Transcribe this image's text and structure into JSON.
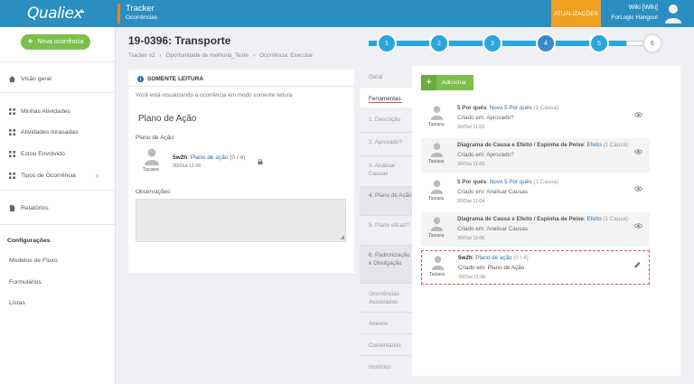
{
  "header": {
    "logo": "Qualiex",
    "module_title": "Tracker",
    "module_subtitle": "Ocorrências",
    "updates_label": "ATUALIZAÇÕES",
    "user_name": "Wiki [Wiki]",
    "user_org": "ForLogic Hangout",
    "accent_color": "#2a8fc0"
  },
  "sidebar": {
    "new_button": "Nova ocorrência",
    "items": [
      {
        "label": "Visão geral",
        "icon": "home-icon"
      },
      {
        "label": "Minhas Atividades",
        "icon": "grid-icon"
      },
      {
        "label": "Atividades Atrasadas",
        "icon": "grid-icon"
      },
      {
        "label": "Estou Envolvido",
        "icon": "grid-icon"
      },
      {
        "label": "Tipos de Ocorrência",
        "icon": "grid-icon"
      },
      {
        "label": "Relatórios",
        "icon": "document-icon"
      }
    ],
    "config_heading": "Configurações",
    "config_items": [
      "Modelos de Fluxo",
      "Formulários",
      "Listas"
    ]
  },
  "page": {
    "title": "19-0396: Transporte",
    "breadcrumb": [
      "Tracker v2",
      "›",
      "Oportunidade de melhoria_Teste",
      "›",
      "Ocorrência: Executar"
    ]
  },
  "steps": {
    "labels": [
      "1",
      "2",
      "3",
      "4",
      "5",
      "6"
    ],
    "current": 4
  },
  "readonly": {
    "heading": "SOMENTE LEITURA",
    "text": "Você está visualizando a ocorrência em modo somente leitura"
  },
  "plan": {
    "title": "Plano de Ação",
    "label": "Plano de Ação:",
    "user": "Taciara",
    "tool_name": "5w2h",
    "link": "Plano de ação",
    "count": "(0 / 4)",
    "date": "30/Out 11:06",
    "obs_label": "Observações:"
  },
  "tabs": {
    "items": [
      "Geral",
      "Ferramentas",
      "1. Descrição",
      "2. Aprovado?",
      "3. Analisar Causas",
      "4. Plano de Ação",
      "5. Plano eficaz?",
      "6. Padronização e Divulgação",
      "Ocorrências Associadas",
      "Anexos",
      "Comentários",
      "Histórico"
    ]
  },
  "tools": {
    "add_button": "Adicionar",
    "items": [
      {
        "user": "Taciara",
        "name": "5 Por quês",
        "link": "Novo 5 Por quês",
        "count": "(1 Causa)",
        "created": "Criado em: Aprovado?",
        "date": "30/Out 11:03",
        "action": "eye-icon"
      },
      {
        "user": "Taciara",
        "name": "Diagrama de Causa e Efeito / Espinha de Peixe",
        "link": "Efeito",
        "count": "(1 Causa)",
        "created": "Criado em: Aprovado?",
        "date": "30/Out 11:03",
        "action": "eye-icon"
      },
      {
        "user": "Taciara",
        "name": "5 Por quês",
        "link": "Novo 5 Por quês",
        "count": "(1 Causa)",
        "created": "Criado em: Analisar Causas",
        "date": "30/Out 11:04",
        "action": "eye-icon"
      },
      {
        "user": "Taciara",
        "name": "Diagrama de Causa e Efeito / Espinha de Peixe",
        "link": "Efeito",
        "count": "(1 Causa)",
        "created": "Criado em: Analisar Causas",
        "date": "30/Out 11:05",
        "action": "eye-icon"
      },
      {
        "user": "Taciara",
        "name": "5w2h",
        "link": "Plano de ação",
        "count": "(0 / 4)",
        "created": "Criado em: Plano de Ação",
        "date": "30/Out 11:06",
        "action": "pencil-icon"
      }
    ]
  }
}
